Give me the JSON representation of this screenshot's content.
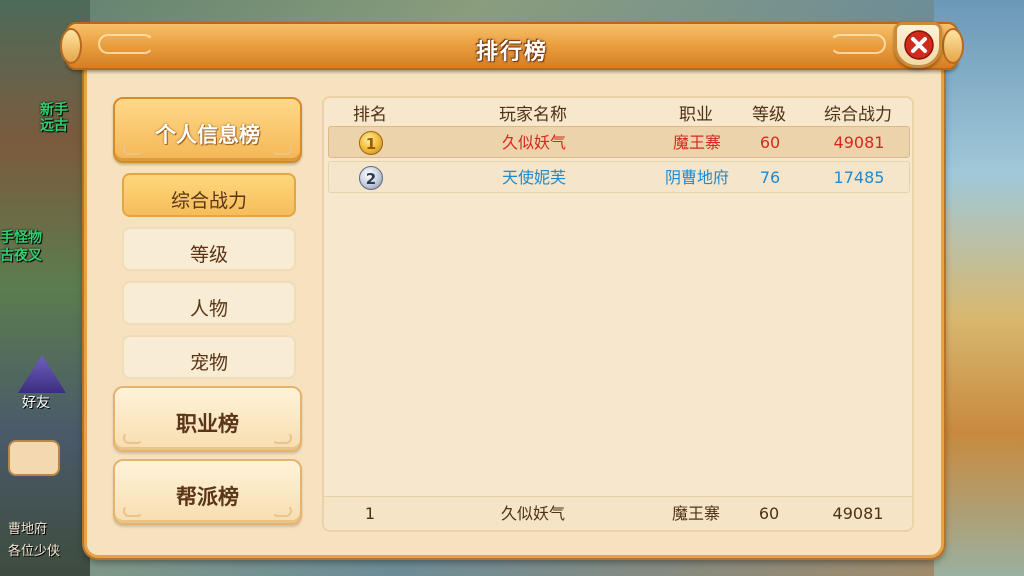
{
  "background": {
    "side_text_1": "新手",
    "side_text_2": "远古",
    "side_text_3": "手怪物",
    "side_text_4": "古夜叉",
    "friend_label": "好友",
    "chat_line_1": "曹地府",
    "chat_line_2": "各位少侠"
  },
  "dialog": {
    "title": "排行榜",
    "close_icon": "close-x-icon"
  },
  "nav": {
    "personal": "个人信息榜",
    "sub_items": [
      "综合战力",
      "等级",
      "人物",
      "宠物"
    ],
    "class_board": "职业榜",
    "guild_board": "帮派榜"
  },
  "table": {
    "headers": {
      "rank": "排名",
      "name": "玩家名称",
      "class": "职业",
      "level": "等级",
      "power": "综合战力"
    },
    "rows": [
      {
        "rank": "1",
        "name": "久似妖气",
        "class": "魔王寨",
        "level": "60",
        "power": "49081",
        "color": "#d42a1e"
      },
      {
        "rank": "2",
        "name": "天使妮芙",
        "class": "阴曹地府",
        "level": "76",
        "power": "17485",
        "color": "#1e8ad0"
      }
    ],
    "my_row": {
      "rank": "1",
      "name": "久似妖气",
      "class": "魔王寨",
      "level": "60",
      "power": "49081"
    }
  },
  "colors": {
    "accent_orange": "#e89a3a",
    "panel_bg": "#f6e2bf",
    "rank1_text": "#d42a1e",
    "rank2_text": "#1e8ad0"
  }
}
